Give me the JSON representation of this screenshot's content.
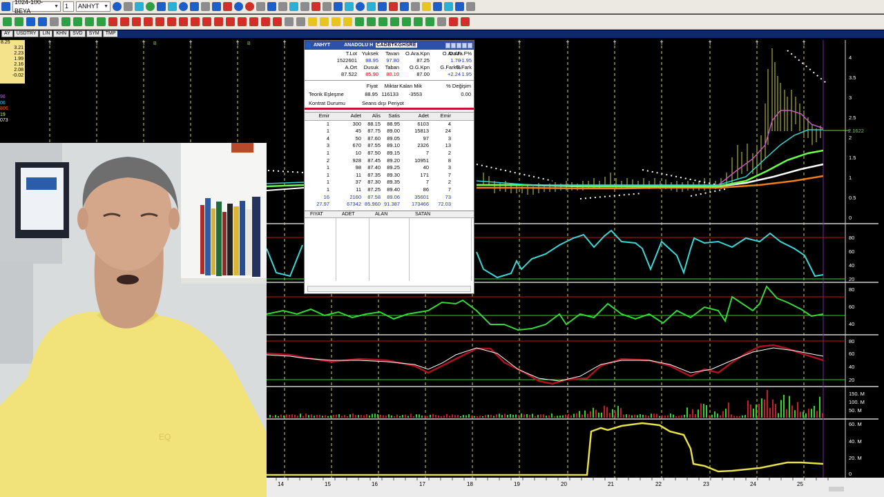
{
  "toolbar": {
    "layout_combo": "1024-100-BEYA",
    "page_combo": "1",
    "symbol_combo": "ANHYT",
    "secondary_tabs": [
      "AY",
      "USDTRY",
      "LIN",
      "KHN",
      "SVD",
      "SYM",
      "TMP"
    ]
  },
  "mini_panel": {
    "values": [
      "8.25",
      "3.21",
      "2.23",
      "1.99",
      "2.16",
      "2.08",
      "-0.02"
    ]
  },
  "left_values": [
    {
      "text": "96",
      "color": "#e24bd8"
    },
    {
      "text": "06",
      "color": "#2fc8ff"
    },
    {
      "text": "806",
      "color": "#ff5c2b"
    },
    {
      "text": "19",
      "color": "#b8ff4a"
    },
    {
      "text": "073",
      "color": "#ffffff"
    }
  ],
  "chart_labels": {
    "marker_t": "T",
    "marker_b": "B",
    "price_now": "2.1622",
    "price_axis": [
      "4",
      "3.5",
      "3",
      "2.5",
      "2",
      "1.5",
      "1",
      "0.5",
      "0"
    ],
    "rsi_axis": [
      "80",
      "60",
      "40",
      "20"
    ],
    "ind2_axis": [
      "80",
      "60",
      "40"
    ],
    "ind3_axis": [
      "80",
      "60",
      "40",
      "20"
    ],
    "vol_axis": [
      "150. M",
      "100. M",
      "50. M"
    ],
    "last_axis": [
      "60. M",
      "40. M",
      "20. M",
      "0"
    ],
    "dates": [
      "14",
      "15",
      "16",
      "17",
      "18",
      "19",
      "20",
      "21",
      "22",
      "23",
      "24",
      "25"
    ]
  },
  "order_book": {
    "title_symbol": "ANHYT",
    "title_name": "ANADOLU H",
    "title_code": "CADBTKGHSRE",
    "summary": {
      "h1": [
        "T.Lot",
        "Yuksek",
        "Tavan",
        "O.Ara.Kpn",
        "O.Ara.F",
        "O.Ara.F%"
      ],
      "v1": [
        "1522601",
        "88.95",
        "97.80",
        "87.25",
        "1.70",
        "+1.95"
      ],
      "h2": [
        "A.Ort",
        "Dusuk",
        "Taban",
        "O.G.Kpn",
        "G.Fark%",
        "G.Fark"
      ],
      "v2": [
        "87.522",
        "85.90",
        "80.10",
        "87.00",
        "+2.24",
        "1.95"
      ]
    },
    "teorik": {
      "headers": [
        "",
        "Fiyat",
        "Miktar",
        "Kalan Mik",
        "% Değişim"
      ],
      "label": "Teorik Eşleşme",
      "values": [
        "88.95",
        "116133",
        "-3553",
        "0.00"
      ],
      "kontrat_label": "Kontrat Durumu",
      "kontrat_value": "Seans dışı Periyot"
    },
    "book_headers": [
      "Emir",
      "Adet",
      "Alis",
      "Satis",
      "Adet",
      "Emir"
    ],
    "rows": [
      [
        "1",
        "300",
        "88.15",
        "88.95",
        "6103",
        "4"
      ],
      [
        "1",
        "45",
        "87.75",
        "89.00",
        "15813",
        "24"
      ],
      [
        "4",
        "50",
        "87.60",
        "89.05",
        "97",
        "3"
      ],
      [
        "3",
        "670",
        "87.55",
        "89.10",
        "2326",
        "13"
      ],
      [
        "1",
        "10",
        "87.50",
        "89.15",
        "7",
        "2"
      ],
      [
        "2",
        "928",
        "87.45",
        "89.20",
        "10951",
        "8"
      ],
      [
        "1",
        "98",
        "87.40",
        "89.25",
        "40",
        "3"
      ],
      [
        "1",
        "11",
        "87.35",
        "89.30",
        "171",
        "7"
      ],
      [
        "1",
        "37",
        "87.30",
        "89.35",
        "7",
        "2"
      ],
      [
        "1",
        "11",
        "87.25",
        "89.40",
        "86",
        "7"
      ],
      [
        "16",
        "2160",
        "87.58",
        "89.06",
        "35601",
        "73"
      ],
      [
        "27.97",
        "67342",
        "85.960",
        "91.387",
        "173466",
        "72.03"
      ]
    ],
    "trade_headers": [
      "FIYAT",
      "ADET",
      "ALAN",
      "SATAN"
    ]
  }
}
